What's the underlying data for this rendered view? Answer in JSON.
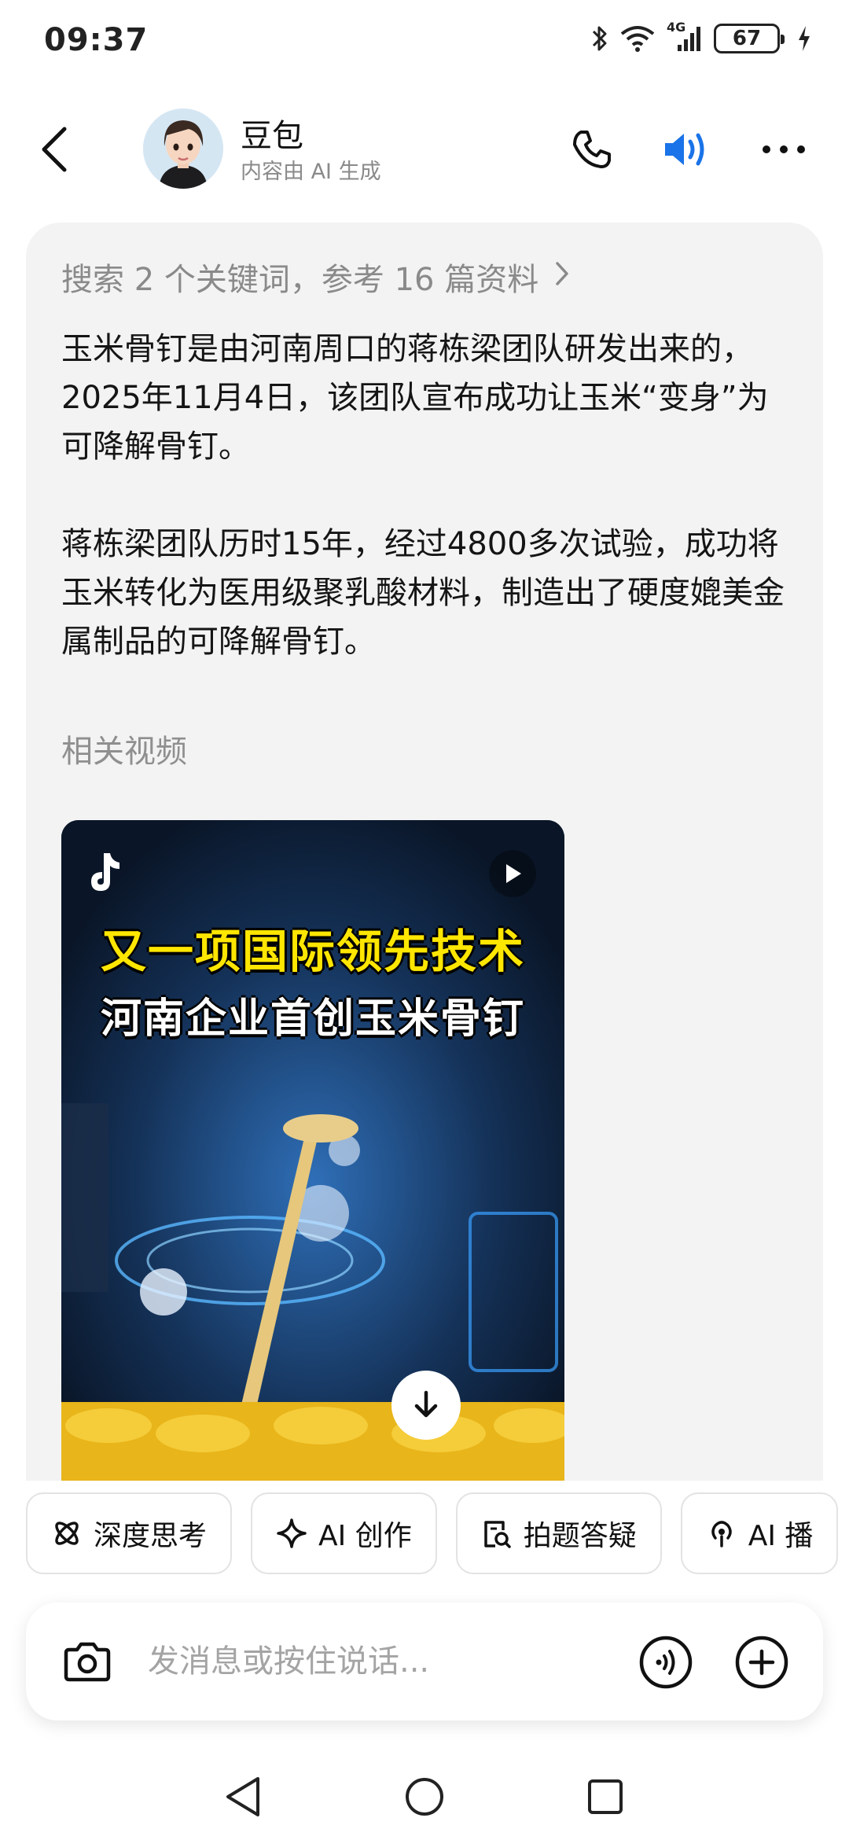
{
  "status_bar": {
    "time": "09:37",
    "network": "4G",
    "battery": "67",
    "icons": [
      "bluetooth-icon",
      "wifi-icon",
      "signal-icon",
      "battery-icon",
      "charging-icon"
    ]
  },
  "header": {
    "title": "豆包",
    "subtitle": "内容由 AI 生成",
    "icons": [
      "back-icon",
      "phone-icon",
      "speaker-icon",
      "more-icon"
    ],
    "accent_color": "#1a73e8"
  },
  "message": {
    "search_summary": "搜索 2 个关键词，参考 16 篇资料",
    "paragraphs": [
      "玉米骨钉是由河南周口的蒋栋梁团队研发出来的，2025年11月4日，该团队宣布成功让玉米“变身”为可降解骨钉。",
      "蒋栋梁团队历时15年，经过4800多次试验，成功将玉米转化为医用级聚乳酸材料，制造出了硬度媲美金属制品的可降解骨钉。"
    ],
    "related_label": "相关视频",
    "video": {
      "title_line1": "又一项国际领先技术",
      "title_line2": "河南企业首创玉米骨钉",
      "title_color": "#ffe600"
    }
  },
  "quick_actions": [
    {
      "label": "深度思考",
      "icon": "atom-icon"
    },
    {
      "label": "AI 创作",
      "icon": "sparkle-icon"
    },
    {
      "label": "拍题答疑",
      "icon": "scan-doc-icon"
    },
    {
      "label": "AI 播",
      "icon": "podcast-icon"
    }
  ],
  "input": {
    "placeholder": "发消息或按住说话..."
  },
  "nav": [
    "nav-back-icon",
    "nav-home-icon",
    "nav-recent-icon"
  ]
}
